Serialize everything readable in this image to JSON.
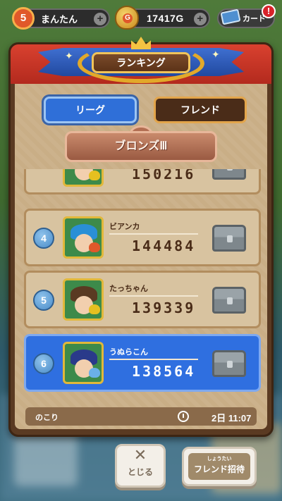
{
  "topbar": {
    "player_level": "5",
    "player_name": "まんたん",
    "gold_amount": "17417G",
    "gold_icon_letter": "G",
    "card_label": "カード",
    "alert_mark": "!",
    "plus_glyph": "+"
  },
  "ranking": {
    "title": "ランキング",
    "tabs": [
      {
        "label": "リーグ",
        "selected": true
      },
      {
        "label": "フレンド",
        "selected": false
      }
    ],
    "league_name": "ブロンズⅢ"
  },
  "rows": [
    {
      "rank": "",
      "name": "",
      "score": "150216",
      "hair_color": "#6b4fb0",
      "slime_color": "#e6c020",
      "is_me": false
    },
    {
      "rank": "4",
      "name": "ビアンカ",
      "score": "144484",
      "hair_color": "#2a8fd6",
      "slime_color": "#e0582a",
      "is_me": false
    },
    {
      "rank": "5",
      "name": "たっちゃん",
      "score": "139339",
      "hair_color": "#5a3a22",
      "slime_color": "#e6c020",
      "is_me": false
    },
    {
      "rank": "6",
      "name": "うぬらこん",
      "score": "138564",
      "hair_color": "#2a3a8a",
      "slime_color": "#6ab0e8",
      "is_me": true
    }
  ],
  "timer": {
    "label": "のこり",
    "value": "2日 11:07"
  },
  "buttons": {
    "close_glyph": "✕",
    "close_label": "とじる",
    "invite_ruby": "しょうたい",
    "invite_label": "フレンド招待"
  },
  "colors": {
    "accent_blue": "#2f6fe0",
    "header_red": "#c3321f",
    "panel_tan": "#c9ae86",
    "gold_trim": "#e2a92a"
  }
}
